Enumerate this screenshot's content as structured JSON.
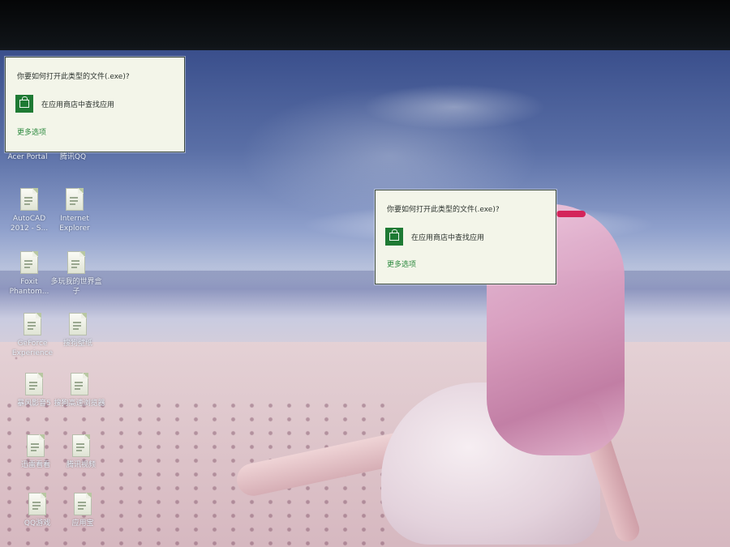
{
  "dialog": {
    "title": "你要如何打开此类型的文件(.exe)?",
    "store_option_label": "在应用商店中查找应用",
    "store_icon": "windows-store-icon",
    "more_options_label": "更多选项",
    "accent_color": "#1e7a34",
    "link_color": "#2d8a3f"
  },
  "desktop_icons": {
    "acer_portal": "Acer Portal",
    "tencent_qq": "腾讯QQ",
    "autocad": "AutoCAD 2012 - S...",
    "internet_explorer": "Internet Explorer",
    "foxit": "Foxit Phantom...",
    "duowan": "多玩我的世界盒子",
    "geforce": "GeForce Experience",
    "sougou": "搜狗壁纸",
    "baofeng": "暴风影音5",
    "sougou_browser": "搜狗高速浏览器",
    "row6_left": "迅雷看看",
    "row6_right": "腾讯视频",
    "row7_left": "QQ游戏",
    "row7_right": "应用宝"
  }
}
